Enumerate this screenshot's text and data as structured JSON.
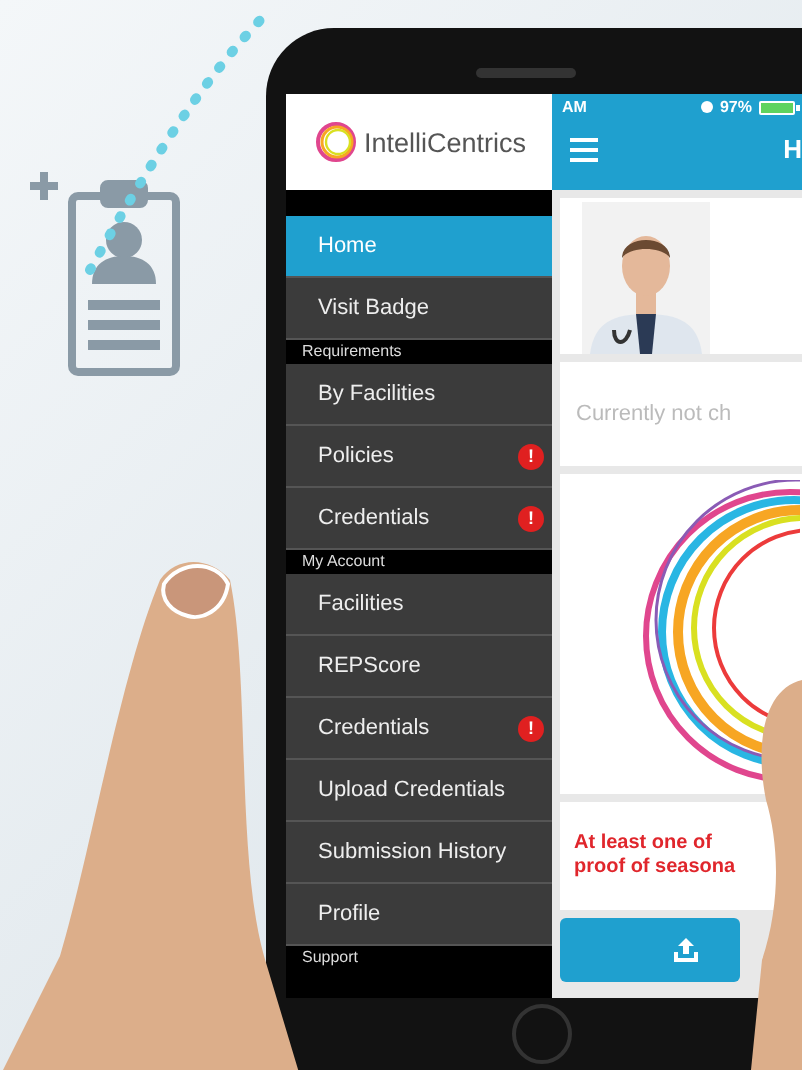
{
  "status_bar": {
    "time": "AM",
    "battery": "97%"
  },
  "logo": {
    "name": "IntelliCentrics"
  },
  "menu": [
    {
      "kind": "item",
      "label": "Home",
      "selected": true,
      "alert": false
    },
    {
      "kind": "item",
      "label": "Visit Badge",
      "selected": false,
      "alert": false
    },
    {
      "kind": "section",
      "label": "Requirements"
    },
    {
      "kind": "item",
      "label": "By Facilities",
      "selected": false,
      "alert": false
    },
    {
      "kind": "item",
      "label": "Policies",
      "selected": false,
      "alert": true
    },
    {
      "kind": "item",
      "label": "Credentials",
      "selected": false,
      "alert": true
    },
    {
      "kind": "section",
      "label": "My Account"
    },
    {
      "kind": "item",
      "label": "Facilities",
      "selected": false,
      "alert": false
    },
    {
      "kind": "item",
      "label": "REPScore",
      "selected": false,
      "alert": false
    },
    {
      "kind": "item",
      "label": "Credentials",
      "selected": false,
      "alert": true
    },
    {
      "kind": "item",
      "label": "Upload Credentials",
      "selected": false,
      "alert": false
    },
    {
      "kind": "item",
      "label": "Submission History",
      "selected": false,
      "alert": false
    },
    {
      "kind": "item",
      "label": "Profile",
      "selected": false,
      "alert": false
    },
    {
      "kind": "section",
      "label": "Support"
    }
  ],
  "header": {
    "title": "H"
  },
  "status_card": {
    "text": "Currently not ch"
  },
  "message": {
    "lines": [
      "At least one of",
      "proof of seasona"
    ]
  },
  "alert_mark": "!"
}
